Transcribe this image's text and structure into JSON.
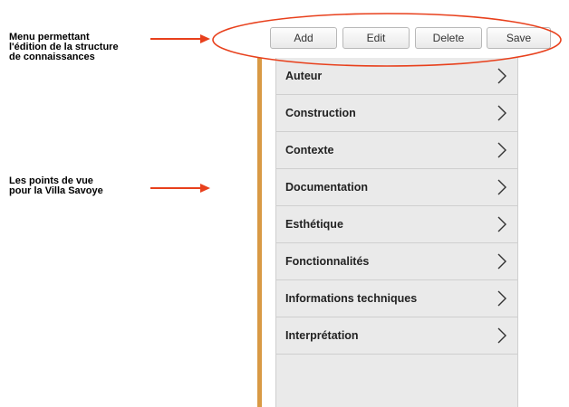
{
  "annotations": {
    "menu": [
      "Menu permettant",
      "l'édition de la structure",
      "de connaissances"
    ],
    "viewpoints": [
      "Les points de vue",
      "pour la Villa Savoye"
    ]
  },
  "toolbar": {
    "add_label": "Add",
    "edit_label": "Edit",
    "delete_label": "Delete",
    "save_label": "Save"
  },
  "list": {
    "items": [
      {
        "label": "Auteur"
      },
      {
        "label": "Construction"
      },
      {
        "label": "Contexte"
      },
      {
        "label": "Documentation"
      },
      {
        "label": "Esthétique"
      },
      {
        "label": "Fonctionnalités"
      },
      {
        "label": "Informations techniques"
      },
      {
        "label": "Interprétation"
      }
    ]
  },
  "colors": {
    "arrow": "#e8401c",
    "ellipse": "#e8401c",
    "panel_accent": "#d99a45",
    "list_background": "#eaeaea"
  },
  "icons": {
    "item_chevron": "chevron-right-icon"
  }
}
